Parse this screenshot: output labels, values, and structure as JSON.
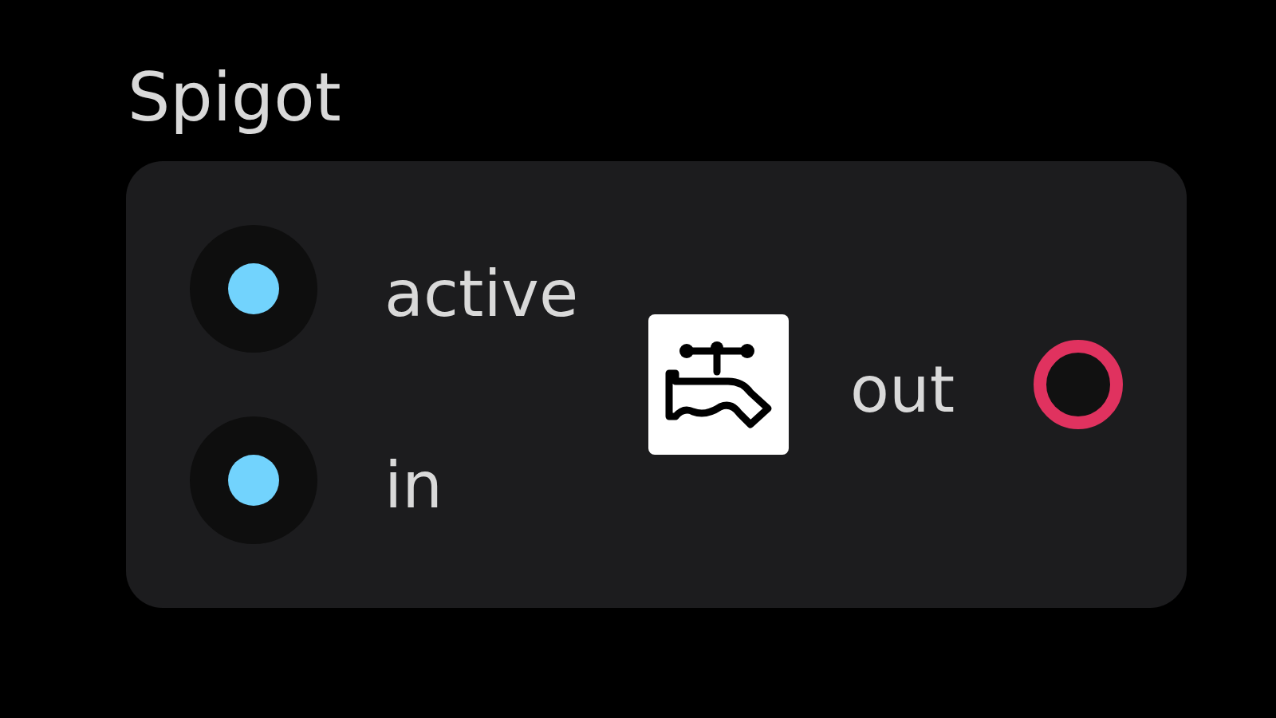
{
  "node": {
    "title": "Spigot",
    "inputs": [
      {
        "label": "active"
      },
      {
        "label": "in"
      }
    ],
    "output": {
      "label": "out"
    }
  }
}
